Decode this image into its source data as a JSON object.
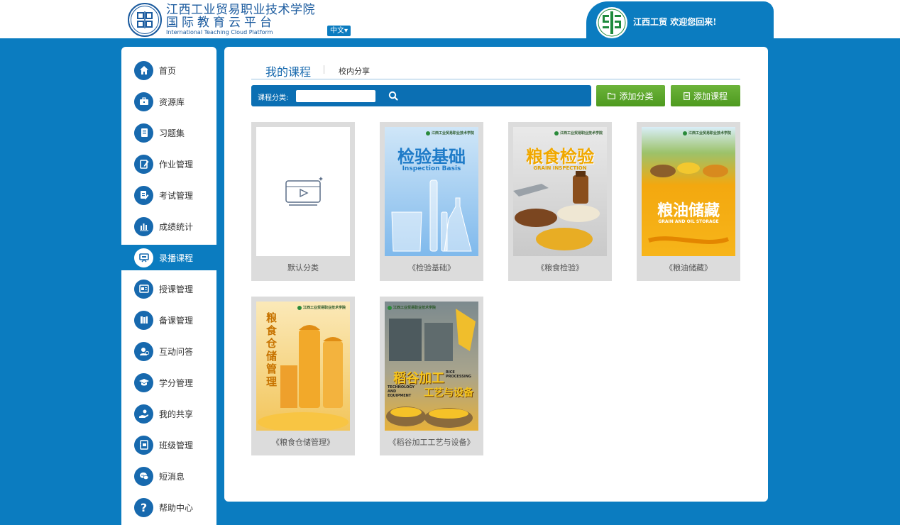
{
  "header": {
    "school_name_cn": "江西工业贸易职业技术学院",
    "platform_name_cn": "国际教育云平台",
    "platform_name_en": "International Teaching Cloud Platform",
    "language": "中文",
    "user_school": "江西工贸",
    "greeting": "欢迎您回来!"
  },
  "sidebar": {
    "items": [
      {
        "label": "首页",
        "icon": "home-icon"
      },
      {
        "label": "资源库",
        "icon": "briefcase-icon"
      },
      {
        "label": "习题集",
        "icon": "notebook-icon"
      },
      {
        "label": "作业管理",
        "icon": "edit-icon"
      },
      {
        "label": "考试管理",
        "icon": "exam-icon"
      },
      {
        "label": "成绩统计",
        "icon": "bar-chart-icon"
      },
      {
        "label": "录播课程",
        "icon": "presentation-icon",
        "active": true
      },
      {
        "label": "授课管理",
        "icon": "teaching-icon"
      },
      {
        "label": "备课管理",
        "icon": "books-icon"
      },
      {
        "label": "互动问答",
        "icon": "qa-icon"
      },
      {
        "label": "学分管理",
        "icon": "graduation-cap-icon"
      },
      {
        "label": "我的共享",
        "icon": "share-hand-icon"
      },
      {
        "label": "班级管理",
        "icon": "class-icon"
      },
      {
        "label": "短消息",
        "icon": "message-icon"
      },
      {
        "label": "帮助中心",
        "icon": "help-icon"
      }
    ]
  },
  "main": {
    "tab_active": "我的课程",
    "tab_other": "校内分享",
    "search_label": "课程分类:",
    "search_value": "",
    "add_category_label": "添加分类",
    "add_course_label": "添加课程",
    "cards": [
      {
        "title": "默认分类",
        "cover": "default"
      },
      {
        "title": "《检验基础》",
        "cover": "inspection",
        "cover_title": "检验基础",
        "cover_sub": "Inspection Basis"
      },
      {
        "title": "《粮食检验》",
        "cover": "grain-inspect",
        "cover_title": "粮食检验",
        "cover_sub": "GRAIN INSPECTION"
      },
      {
        "title": "《粮油储藏》",
        "cover": "grain-oil",
        "cover_title": "粮油储藏",
        "cover_sub": "GRAIN AND OIL STORAGE"
      },
      {
        "title": "《粮食仓储管理》",
        "cover": "warehouse",
        "cover_title": "粮食仓储管理"
      },
      {
        "title": "《稻谷加工工艺与设备》",
        "cover": "rice",
        "cover_title": "稻谷加工",
        "cover_title_2": "工艺与设备",
        "cover_sub": "RICE PROCESSING",
        "cover_sub_2": "TECHNOLOGY AND EQUIPMENT"
      }
    ],
    "cover_school_label": "江西工业贸易职业技术学院"
  },
  "colors": {
    "brand_blue": "#0b7cc0",
    "nav_icon_blue": "#1769ae",
    "button_green": "#5aa72a"
  }
}
